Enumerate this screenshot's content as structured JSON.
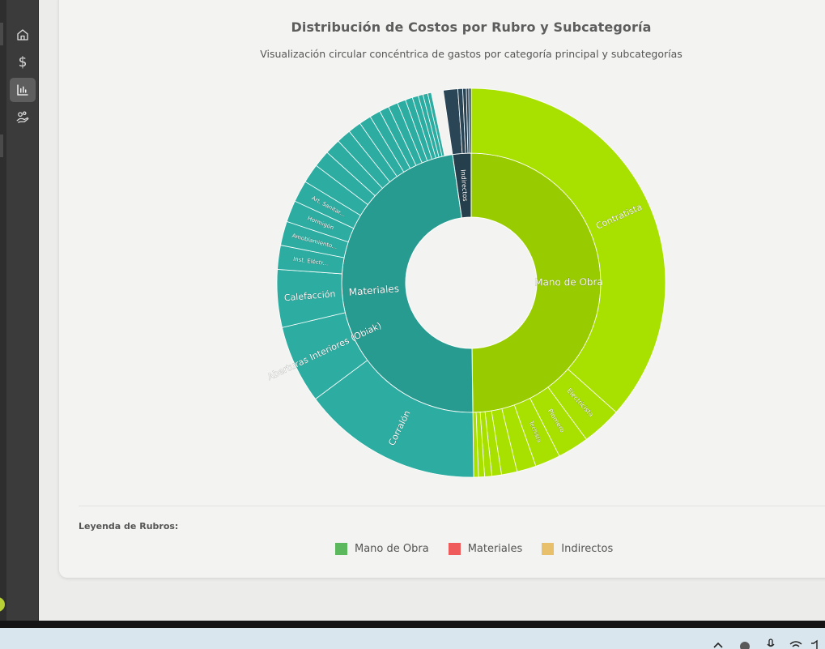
{
  "sidebar": {
    "items": [
      {
        "name": "home-icon",
        "active": false
      },
      {
        "name": "dollar-icon",
        "active": false,
        "glyph": "$"
      },
      {
        "name": "bar-chart-icon",
        "active": true
      },
      {
        "name": "hand-coins-icon",
        "active": false
      }
    ]
  },
  "colors": {
    "mano_inner": "#99cc00",
    "mano_outer": "#a8e100",
    "materiales_inner": "#289b90",
    "materiales_outer": "#2dada1",
    "indirectos_inner": "#253f4d",
    "indirectos_outer": "#2a4555",
    "legend_mano": "#5cb85c",
    "legend_materiales": "#ef5b5b",
    "legend_indirectos": "#e8bf6a"
  },
  "chart_data": {
    "type": "sunburst",
    "title": "Distribución de Costos por Rubro y Subcategoría",
    "subtitle": "Visualización circular concéntrica de gastos por categoría principal y subcategorías",
    "inner_ring": [
      {
        "name": "Mano de Obra",
        "value": 49.8,
        "color_key": "mano"
      },
      {
        "name": "Materiales",
        "value": 47.9,
        "color_key": "materiales"
      },
      {
        "name": "Indirectos",
        "value": 2.3,
        "color_key": "indirectos"
      }
    ],
    "outer_ring": [
      {
        "parent": "Mano de Obra",
        "name": "Contratista",
        "value": 36.6
      },
      {
        "parent": "Mano de Obra",
        "name": "Electricista",
        "value": 3.3
      },
      {
        "parent": "Mano de Obra",
        "name": "Plomero",
        "value": 2.6
      },
      {
        "parent": "Mano de Obra",
        "name": "Techista",
        "value": 2.1
      },
      {
        "parent": "Mano de Obra",
        "name": "",
        "value": 1.6
      },
      {
        "parent": "Mano de Obra",
        "name": "",
        "value": 1.3
      },
      {
        "parent": "Mano de Obra",
        "name": "",
        "value": 0.8
      },
      {
        "parent": "Mano de Obra",
        "name": "",
        "value": 0.6
      },
      {
        "parent": "Mano de Obra",
        "name": "",
        "value": 0.5
      },
      {
        "parent": "Mano de Obra",
        "name": "",
        "value": 0.4
      },
      {
        "parent": "Materiales",
        "name": "Corralón",
        "value": 15.0
      },
      {
        "parent": "Materiales",
        "name": "Aberturas Interiores (Obiak)",
        "value": 6.5
      },
      {
        "parent": "Materiales",
        "name": "Calefacción",
        "value": 4.8
      },
      {
        "parent": "Materiales",
        "name": "Inst. Eléctr...",
        "value": 2.0
      },
      {
        "parent": "Materiales",
        "name": "Amoblamiento...",
        "value": 2.0
      },
      {
        "parent": "Materiales",
        "name": "Hormigón",
        "value": 1.8
      },
      {
        "parent": "Materiales",
        "name": "Art. Sanitar...",
        "value": 1.8
      },
      {
        "parent": "Materiales",
        "name": "",
        "value": 1.6
      },
      {
        "parent": "Materiales",
        "name": "",
        "value": 1.4
      },
      {
        "parent": "Materiales",
        "name": "",
        "value": 1.3
      },
      {
        "parent": "Materiales",
        "name": "",
        "value": 1.2
      },
      {
        "parent": "Materiales",
        "name": "",
        "value": 1.1
      },
      {
        "parent": "Materiales",
        "name": "",
        "value": 1.0
      },
      {
        "parent": "Materiales",
        "name": "",
        "value": 0.9
      },
      {
        "parent": "Materiales",
        "name": "",
        "value": 0.8
      },
      {
        "parent": "Materiales",
        "name": "",
        "value": 0.8
      },
      {
        "parent": "Materiales",
        "name": "",
        "value": 0.7
      },
      {
        "parent": "Materiales",
        "name": "",
        "value": 0.6
      },
      {
        "parent": "Materiales",
        "name": "",
        "value": 0.5
      },
      {
        "parent": "Materiales",
        "name": "",
        "value": 0.4
      },
      {
        "parent": "Materiales",
        "name": "",
        "value": 0.4
      },
      {
        "parent": "Materiales",
        "name": "",
        "value": 0.3
      },
      {
        "parent": "Indirectos",
        "name": "",
        "value": 1.2
      },
      {
        "parent": "Indirectos",
        "name": "",
        "value": 0.4
      },
      {
        "parent": "Indirectos",
        "name": "",
        "value": 0.3
      },
      {
        "parent": "Indirectos",
        "name": "",
        "value": 0.2
      },
      {
        "parent": "Indirectos",
        "name": "",
        "value": 0.2
      }
    ]
  },
  "legend": {
    "title": "Leyenda de Rubros:",
    "items": [
      {
        "label": "Mano de Obra",
        "color_key": "legend_mano"
      },
      {
        "label": "Materiales",
        "color_key": "legend_materiales"
      },
      {
        "label": "Indirectos",
        "color_key": "legend_indirectos"
      }
    ]
  }
}
